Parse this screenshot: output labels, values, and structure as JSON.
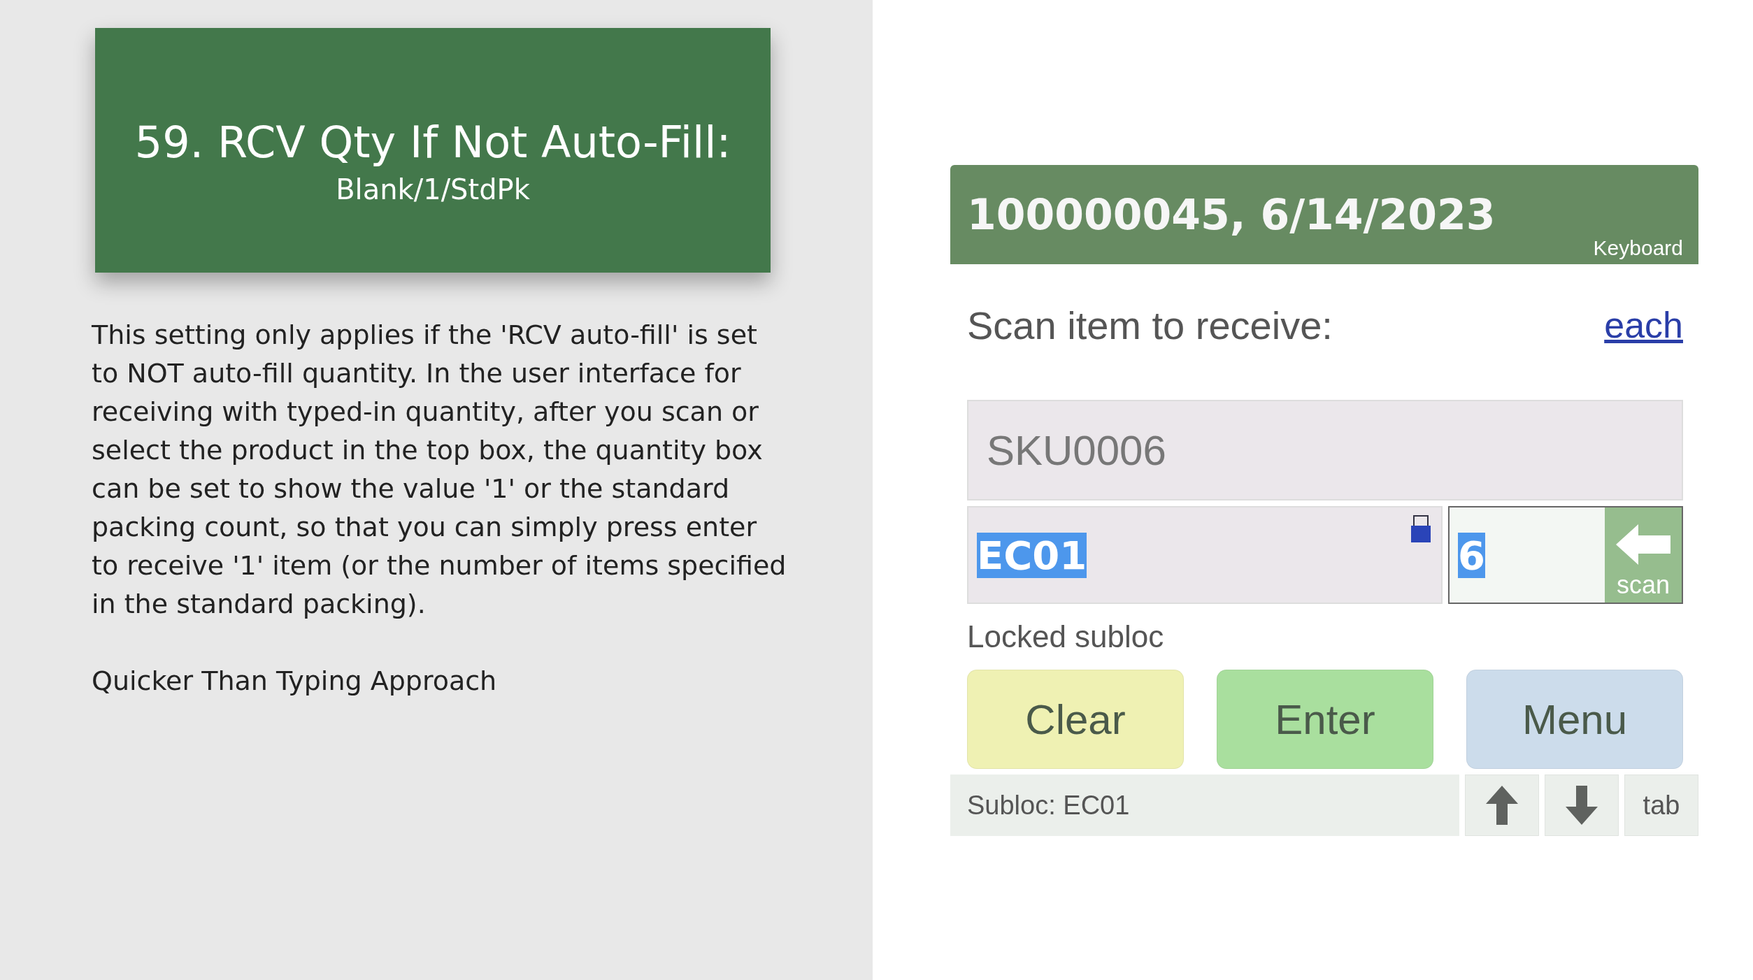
{
  "slide": {
    "title": "59. RCV Qty If Not Auto-Fill:",
    "subtitle": "Blank/1/StdPk",
    "paragraphs": [
      "This setting only applies if the 'RCV auto-fill' is set to NOT auto-fill quantity. In the user interface for receiving with typed-in quantity, after you scan or select the product in the top box, the quantity box can be set to show the value '1' or the standard packing count, so that you can simply press enter to receive '1' item (or the number of items specified in the standard packing).",
      "Quicker Than Typing Approach"
    ]
  },
  "app": {
    "header": {
      "title": "100000045, 6/14/2023",
      "keyboard_label": "Keyboard"
    },
    "prompt": "Scan item to receive:",
    "unit_link": "each",
    "item_field": {
      "value": "SKU0006"
    },
    "subloc_field": {
      "value": "EC01",
      "text_selected": true,
      "locked": true
    },
    "qty_field": {
      "value": "6",
      "text_selected": true
    },
    "scan_button": {
      "label": "scan"
    },
    "lock_note": "Locked subloc",
    "buttons": [
      {
        "label": "Clear",
        "color": "#eff1b3"
      },
      {
        "label": "Enter",
        "color": "#a9df9e"
      },
      {
        "label": "Menu",
        "color": "#ccdceb"
      }
    ],
    "status": {
      "text": "Subloc: EC01",
      "tab_label": "tab"
    }
  }
}
